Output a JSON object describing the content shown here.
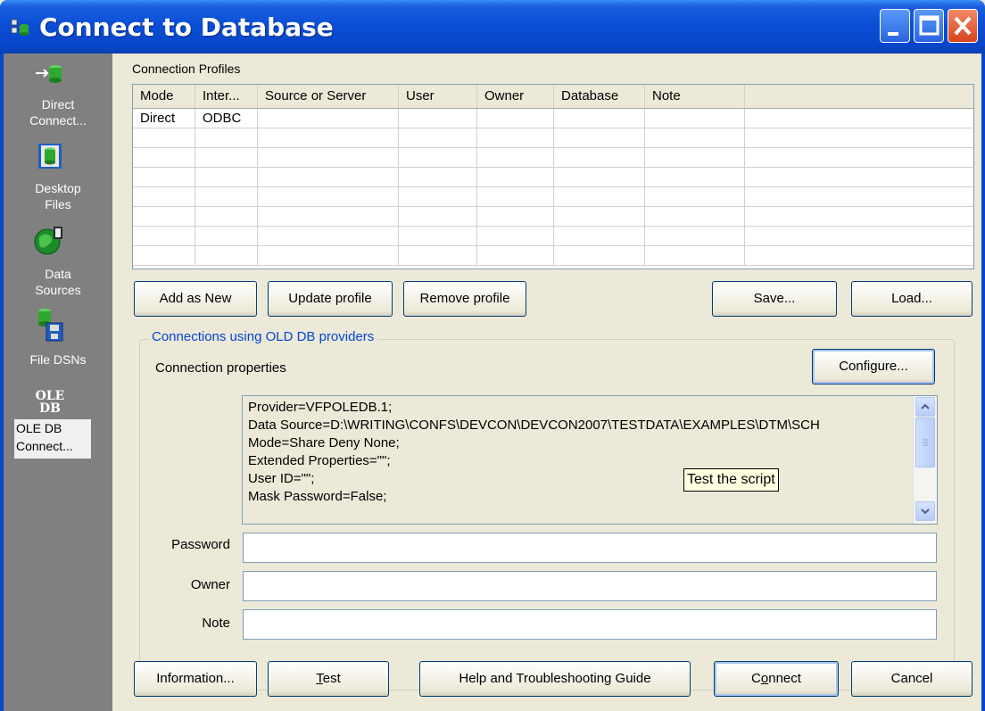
{
  "window": {
    "title": "Connect to Database"
  },
  "sidebar": {
    "items": [
      {
        "label_line1": "Direct",
        "label_line2": "Connect...",
        "icon": "direct-connect-icon"
      },
      {
        "label_line1": "Desktop",
        "label_line2": "Files",
        "icon": "desktop-files-icon"
      },
      {
        "label_line1": "Data",
        "label_line2": "Sources",
        "icon": "data-sources-icon"
      },
      {
        "label_line1": "File DSNs",
        "label_line2": "",
        "icon": "file-dsn-icon"
      },
      {
        "label_line1": "OLE DB",
        "label_line2": "Connect...",
        "icon": "ole-db-icon",
        "icon_text_1": "OLE",
        "icon_text_2": "DB",
        "selected": true
      }
    ]
  },
  "profiles": {
    "section_label": "Connection Profiles",
    "columns": [
      "Mode",
      "Inter...",
      "Source or Server",
      "User",
      "Owner",
      "Database",
      "Note"
    ],
    "rows": [
      [
        "Direct",
        "ODBC",
        "",
        "",
        "",
        "",
        ""
      ]
    ]
  },
  "profile_buttons": {
    "add_new": "Add as New",
    "update": "Update profile",
    "remove": "Remove profile",
    "save": "Save...",
    "load": "Load..."
  },
  "oledb": {
    "group_title": "Connections using OLD DB providers",
    "props_label": "Connection properties",
    "configure": "Configure...",
    "properties": [
      "Provider=VFPOLEDB.1;",
      "Data Source=D:\\WRITING\\CONFS\\DEVCON\\DEVCON2007\\TESTDATA\\EXAMPLES\\DTM\\SCH",
      "Mode=Share Deny None;",
      "Extended Properties=\"\";",
      "User ID=\"\";",
      "Mask Password=False;"
    ],
    "tooltip": "Test the script"
  },
  "fields": {
    "password_label": "Password",
    "owner_label": "Owner",
    "note_label": "Note",
    "password_value": "",
    "owner_value": "",
    "note_value": ""
  },
  "bottom_buttons": {
    "information": "Information...",
    "test_pre": "",
    "test_underline": "T",
    "test_post": "est",
    "help": "Help and Troubleshooting Guide",
    "connect_pre": "C",
    "connect_underline": "o",
    "connect_post": "nnect",
    "cancel": "Cancel"
  }
}
